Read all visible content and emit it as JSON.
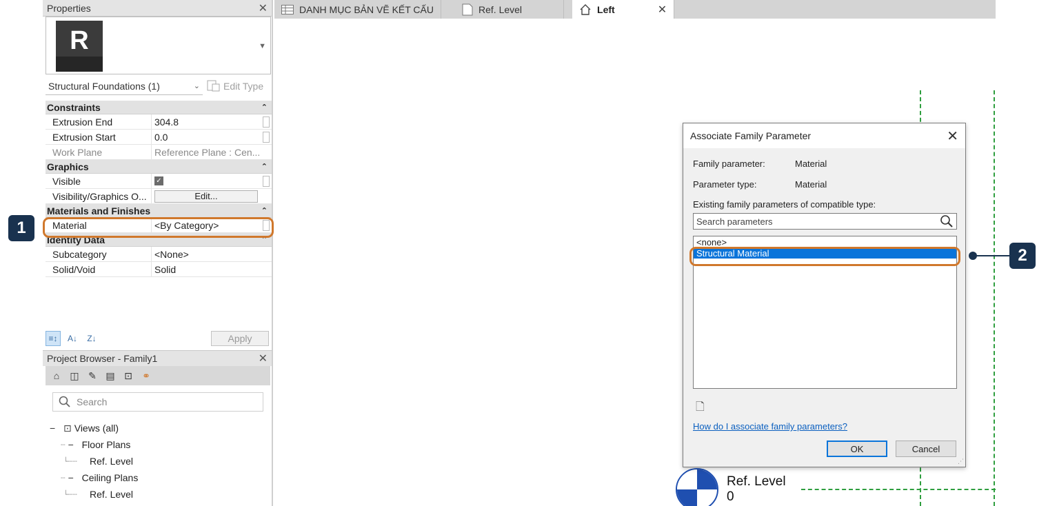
{
  "properties": {
    "title": "Properties",
    "close_glyph": "✕",
    "logo_letter": "R",
    "type_selector": "Structural Foundations (1)",
    "edit_type": "Edit Type",
    "categories": [
      {
        "name": "Constraints",
        "rows": [
          {
            "name": "Extrusion End",
            "value": "304.8"
          },
          {
            "name": "Extrusion Start",
            "value": "0.0"
          },
          {
            "name": "Work Plane",
            "value": "Reference Plane : Cen..."
          }
        ]
      },
      {
        "name": "Graphics",
        "rows": [
          {
            "name": "Visible",
            "value": ""
          },
          {
            "name": "Visibility/Graphics O...",
            "value": "Edit..."
          }
        ]
      },
      {
        "name": "Materials and Finishes",
        "rows": [
          {
            "name": "Material",
            "value": "<By Category>"
          }
        ]
      },
      {
        "name": "Identity Data",
        "rows": [
          {
            "name": "Subcategory",
            "value": "<None>"
          },
          {
            "name": "Solid/Void",
            "value": "Solid"
          }
        ]
      }
    ],
    "apply": "Apply"
  },
  "browser": {
    "title": "Project Browser - Family1",
    "search_placeholder": "Search",
    "tree": [
      {
        "label": "Views (all)"
      },
      {
        "label": "Floor Plans"
      },
      {
        "label": "Ref. Level"
      },
      {
        "label": "Ceiling Plans"
      },
      {
        "label": "Ref. Level"
      }
    ]
  },
  "tabs": [
    {
      "label": "DANH MỤC BẢN VẼ KẾT CẤU"
    },
    {
      "label": "Ref. Level"
    },
    {
      "label": "Left"
    }
  ],
  "canvas": {
    "level_name": "Ref. Level",
    "level_value": "0"
  },
  "dialog": {
    "title": "Associate Family Parameter",
    "family_parameter_label": "Family parameter:",
    "family_parameter_value": "Material",
    "parameter_type_label": "Parameter type:",
    "parameter_type_value": "Material",
    "existing_label": "Existing family parameters of compatible type:",
    "search_placeholder": "Search parameters",
    "list": [
      "<none>",
      "Structural Material"
    ],
    "selected_index": 1,
    "help_link": "How do I associate family parameters?",
    "ok": "OK",
    "cancel": "Cancel"
  },
  "callouts": [
    "1",
    "2"
  ],
  "colors": {
    "callout_bg": "#19324f",
    "highlight_ring": "#d0782c",
    "selection": "#0a74da",
    "reference_line": "#2e9e3e"
  }
}
